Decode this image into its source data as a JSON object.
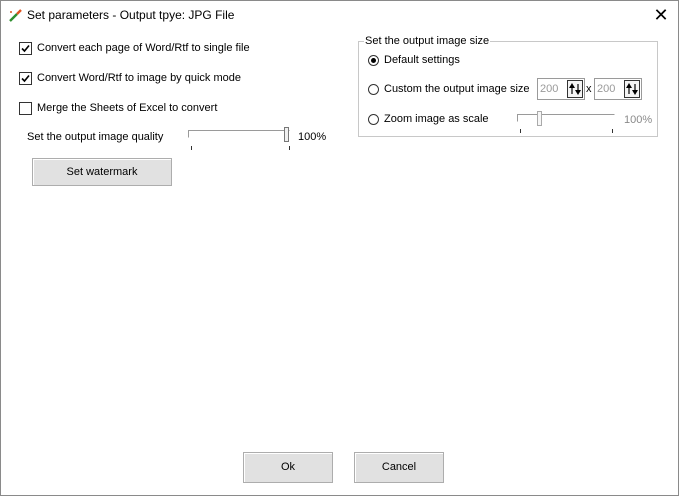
{
  "window": {
    "title": "Set parameters - Output tpye: JPG File",
    "close_glyph": "✕",
    "icon": "app-wand-icon"
  },
  "options": {
    "convert_each_page": {
      "label": "Convert each page of Word/Rtf to single file",
      "checked": true
    },
    "quick_mode": {
      "label": "Convert Word/Rtf to image by quick mode",
      "checked": true
    },
    "merge_sheets": {
      "label": "Merge the Sheets of Excel to convert",
      "checked": false
    }
  },
  "quality": {
    "label": "Set the output image quality",
    "value_text": "100%",
    "value": 1.0
  },
  "watermark_button": "Set watermark",
  "image_size": {
    "group_title": "Set the output image size",
    "default_label": "Default settings",
    "custom_label": "Custom the output image size",
    "zoom_label": "Zoom image as scale",
    "selected": "default",
    "width_value": "200",
    "height_value": "200",
    "separator": "x",
    "zoom_value_text": "100%"
  },
  "footer": {
    "ok_label": "Ok",
    "cancel_label": "Cancel"
  },
  "colors": {
    "window_bg": "#ffffff",
    "button_bg": "#e1e1e1",
    "disabled_text": "#8a8a8a"
  }
}
